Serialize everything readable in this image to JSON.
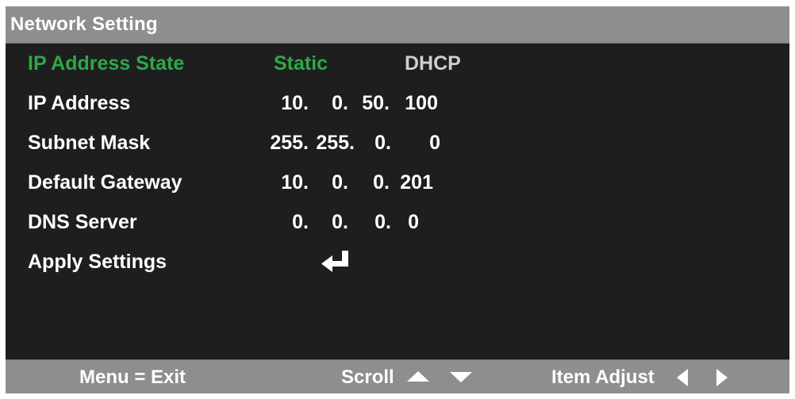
{
  "title": "Network Setting",
  "rows": [
    {
      "label": "IP Address State"
    },
    {
      "label": "IP Address",
      "octets": [
        "10.",
        "0.",
        "50.",
        "100"
      ]
    },
    {
      "label": "Subnet Mask",
      "octets": [
        "255.",
        "255.",
        "0.",
        "0"
      ]
    },
    {
      "label": "Default Gateway",
      "octets": [
        "10.",
        "0.",
        "0.",
        "201"
      ]
    },
    {
      "label": "DNS Server",
      "octets": [
        "0.",
        "0.",
        "0.",
        "0"
      ]
    },
    {
      "label": "Apply Settings"
    }
  ],
  "ip_state_options": [
    "Static",
    "DHCP"
  ],
  "selected_option": "Static",
  "apply_icon": "enter-icon",
  "footer": {
    "menu_hint": "Menu = Exit",
    "scroll_hint": "Scroll",
    "adjust_hint": "Item Adjust",
    "icons": [
      "up-triangle-icon",
      "down-triangle-icon",
      "left-triangle-icon",
      "right-triangle-icon"
    ]
  },
  "colors": {
    "background": "#1e1e1e",
    "bar": "#8e8e8e",
    "highlight": "#2ea84a",
    "text": "#ffffff",
    "dim_text": "#cfcfcf"
  }
}
